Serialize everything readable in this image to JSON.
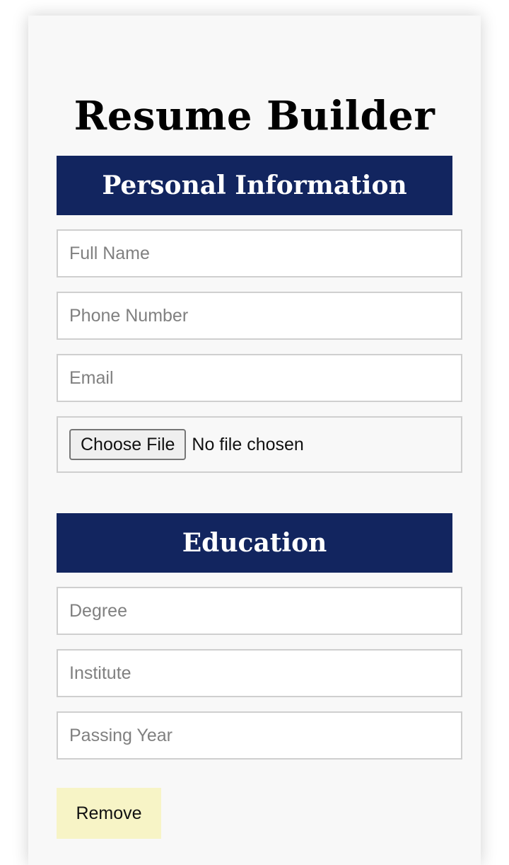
{
  "page": {
    "title": "Resume Builder"
  },
  "personal": {
    "header": "Personal Information",
    "full_name": {
      "placeholder": "Full Name",
      "value": ""
    },
    "phone": {
      "placeholder": "Phone Number",
      "value": ""
    },
    "email": {
      "placeholder": "Email",
      "value": ""
    },
    "photo": {
      "button_label": "Choose File",
      "status": "No file chosen"
    }
  },
  "education": {
    "header": "Education",
    "degree": {
      "placeholder": "Degree",
      "value": ""
    },
    "institute": {
      "placeholder": "Institute",
      "value": ""
    },
    "passing_year": {
      "placeholder": "Passing Year",
      "value": ""
    },
    "remove_label": "Remove"
  },
  "colors": {
    "header_bg": "#12255f",
    "remove_bg": "#f7f4c6",
    "card_bg": "#f8f8f8"
  }
}
